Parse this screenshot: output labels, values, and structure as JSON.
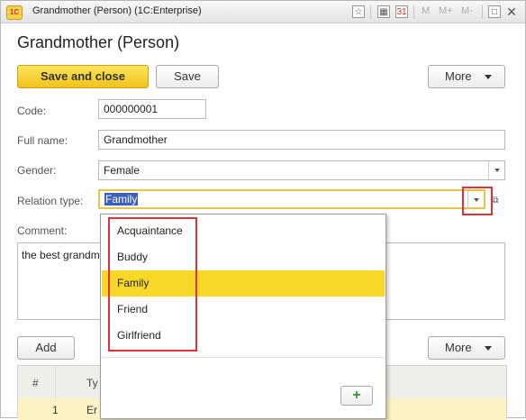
{
  "window": {
    "title": "Grandmother (Person)  (1C:Enterprise)",
    "logo_text": "1C",
    "titlebar_buttons": [
      "M",
      "M+",
      "M-"
    ]
  },
  "form": {
    "heading": "Grandmother (Person)",
    "save_close_label": "Save and close",
    "save_label": "Save",
    "more_label": "More"
  },
  "fields": {
    "code_label": "Code:",
    "code_value": "000000001",
    "fullname_label": "Full name:",
    "fullname_value": "Grandmother",
    "gender_label": "Gender:",
    "gender_value": "Female",
    "relation_label": "Relation type:",
    "relation_value": "Family",
    "comment_label": "Comment:",
    "comment_value": "the best grandm"
  },
  "table_toolbar": {
    "add_label": "Add",
    "more_label": "More"
  },
  "table": {
    "columns": [
      "#",
      "Ty"
    ],
    "rows": [
      {
        "num": "1",
        "type": "Er"
      }
    ]
  },
  "dropdown": {
    "items": [
      "Acquaintance",
      "Buddy",
      "Family",
      "Friend",
      "Girlfriend"
    ],
    "selected": "Family",
    "add_icon": "plus-icon"
  },
  "colors": {
    "accent": "#f2c21a",
    "selection": "#f8d826",
    "highlight_box": "#e0303a"
  }
}
